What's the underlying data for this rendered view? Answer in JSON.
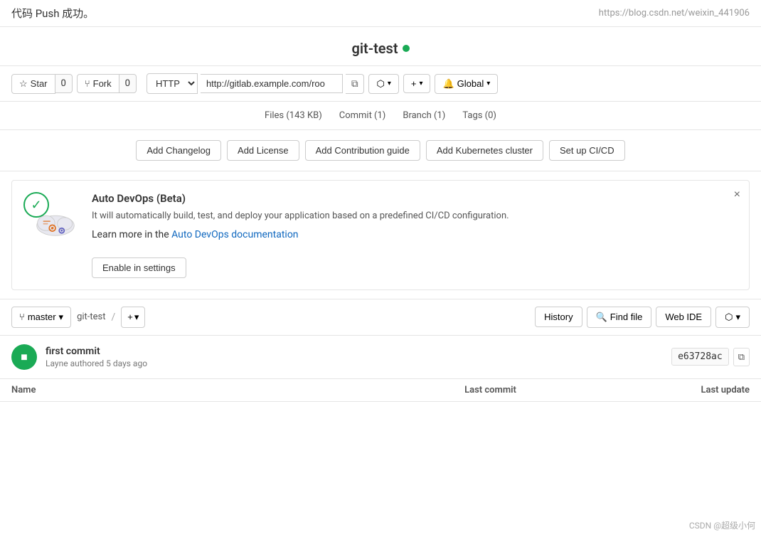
{
  "banner": {
    "title": "代码 Push 成功。",
    "url": "https://blog.csdn.net/weixin_441906"
  },
  "repo": {
    "name": "git-test",
    "dot_color": "#1aaa55"
  },
  "actions": {
    "star_label": "Star",
    "star_count": "0",
    "fork_label": "Fork",
    "fork_count": "0",
    "http_label": "HTTP",
    "url_value": "http://gitlab.example.com/roo",
    "clone_url_placeholder": "http://gitlab.example.com/roo"
  },
  "nav_buttons": {
    "compare_label": "⬡",
    "plus_label": "+",
    "bell_label": "🔔 Global"
  },
  "stats": {
    "files": "Files (143 KB)",
    "commit": "Commit (1)",
    "branch": "Branch (1)",
    "tags": "Tags (0)"
  },
  "quick_actions": [
    {
      "label": "Add Changelog"
    },
    {
      "label": "Add License"
    },
    {
      "label": "Add Contribution guide"
    },
    {
      "label": "Add Kubernetes cluster"
    },
    {
      "label": "Set up CI/CD"
    }
  ],
  "devops": {
    "title": "Auto DevOps (Beta)",
    "description": "It will automatically build, test, and deploy your application based on a predefined CI/CD configuration.",
    "learn_more_prefix": "Learn more in the ",
    "link_text": "Auto DevOps documentation",
    "enable_btn": "Enable in settings",
    "close_label": "×"
  },
  "file_browser": {
    "branch": "master",
    "path": "git-test",
    "plus_btn": "+ ▾",
    "history_btn": "History",
    "find_file_btn": "Find file",
    "web_ide_btn": "Web IDE",
    "compare_icon": "⬡ ▾"
  },
  "commit": {
    "message": "first commit",
    "author": "Layne",
    "time": "authored 5 days ago",
    "hash": "e63728ac",
    "avatar_letter": "■"
  },
  "file_table": {
    "col_name": "Name",
    "col_commit": "Last commit",
    "col_update": "Last update"
  },
  "watermark": "CSDN @超级小何"
}
